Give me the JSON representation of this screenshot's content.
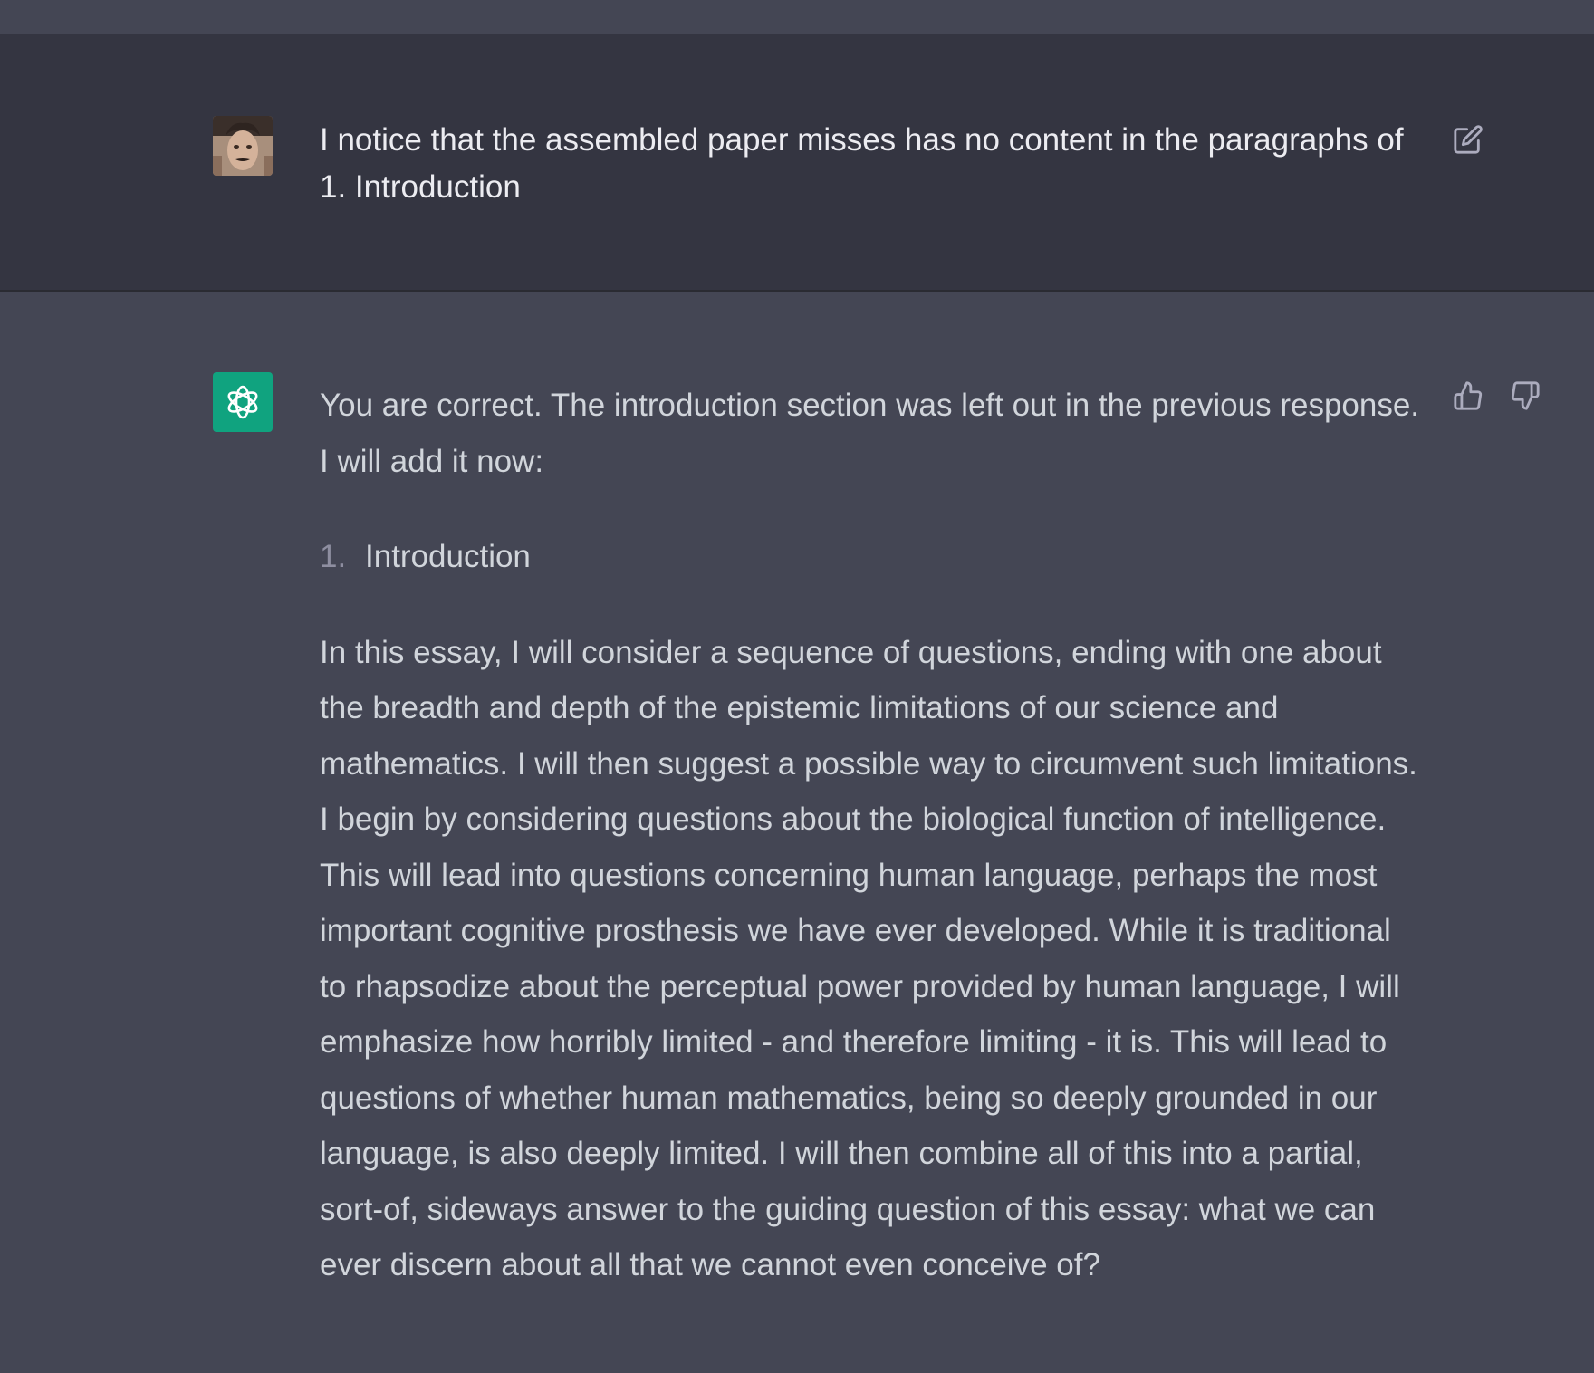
{
  "user_message": {
    "avatar_icon": "user-photo-avatar",
    "text": "I notice that the assembled paper misses has no content in the paragraphs of 1. Introduction",
    "edit_icon": "edit-icon"
  },
  "assistant_message": {
    "avatar_icon": "openai-logo-icon",
    "intro": "You are correct. The introduction section was left out in the previous response. I will add it now:",
    "list_number": "1.",
    "list_item": "Introduction",
    "paragraph": "In this essay, I will consider a sequence of questions, ending with one about the breadth and depth of the epistemic limitations of our science and mathematics. I will then suggest a possible way to circumvent such limitations. I begin by considering questions about the biological function of intelligence. This will lead into questions concerning human language, perhaps the most important cognitive prosthesis we have ever developed. While it is traditional to rhapsodize about the perceptual power provided by human language, I will emphasize how horribly limited - and therefore limiting - it is. This will lead to questions of whether human mathematics, being so deeply grounded in our language, is also deeply limited. I will then combine all of this into a partial, sort-of, sideways answer to the guiding question of this essay: what we can ever discern about all that we cannot even conceive of?",
    "thumbs_up_icon": "thumbs-up-icon",
    "thumbs_down_icon": "thumbs-down-icon"
  },
  "colors": {
    "user_bg": "#343541",
    "assistant_bg": "#444654",
    "brand": "#10a37f"
  }
}
